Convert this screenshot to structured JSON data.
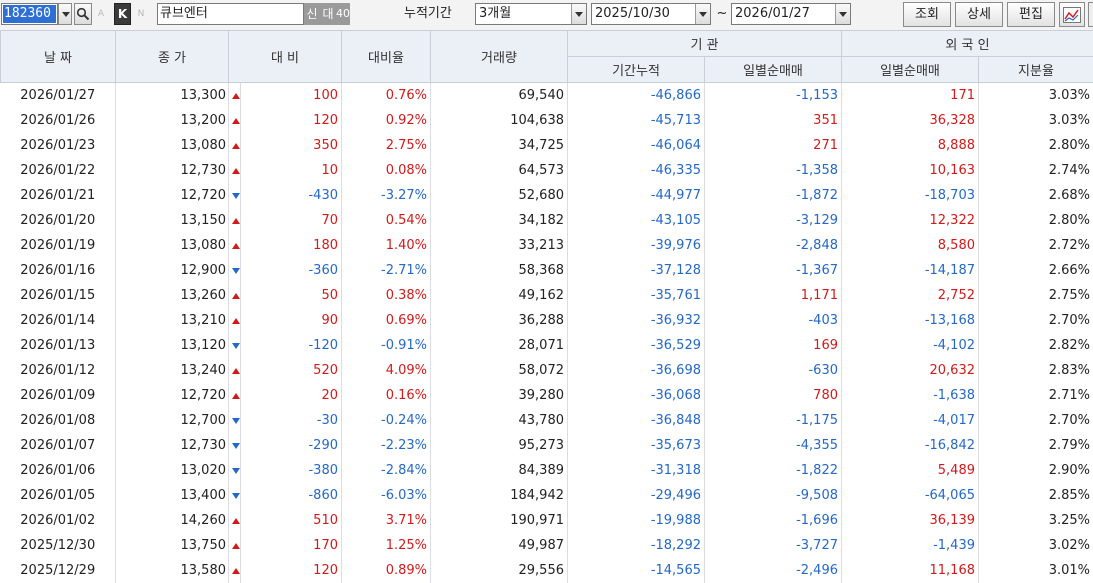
{
  "toolbar": {
    "code": "182360",
    "name": "큐브엔터",
    "k_label": "K",
    "a_label": "A",
    "n_label": "N",
    "badges": [
      "신",
      "대",
      "40"
    ],
    "period_label": "누적기간",
    "period": "3개월",
    "date_from": "2025/10/30",
    "tilde": "~",
    "date_to": "2026/01/27",
    "btn_query": "조회",
    "btn_detail": "상세",
    "btn_edit": "편집"
  },
  "headers": {
    "date": "날 짜",
    "close": "종 가",
    "change": "대 비",
    "change_rate": "대비율",
    "volume": "거래량",
    "institution": "기 관",
    "inst_cum": "기간누적",
    "inst_daily": "일별순매매",
    "foreign": "외 국 인",
    "foreign_daily": "일별순매매",
    "foreign_ratio": "지분율"
  },
  "rows": [
    {
      "date": "2026/01/27",
      "close": "13,300",
      "dir": "up",
      "change": "100",
      "rate": "0.76%",
      "volume": "69,540",
      "inst_cum": "-46,866",
      "inst_daily": "-1,153",
      "for_daily": "171",
      "ratio": "3.03%"
    },
    {
      "date": "2026/01/26",
      "close": "13,200",
      "dir": "up",
      "change": "120",
      "rate": "0.92%",
      "volume": "104,638",
      "inst_cum": "-45,713",
      "inst_daily": "351",
      "for_daily": "36,328",
      "ratio": "3.03%"
    },
    {
      "date": "2026/01/23",
      "close": "13,080",
      "dir": "up",
      "change": "350",
      "rate": "2.75%",
      "volume": "34,725",
      "inst_cum": "-46,064",
      "inst_daily": "271",
      "for_daily": "8,888",
      "ratio": "2.80%"
    },
    {
      "date": "2026/01/22",
      "close": "12,730",
      "dir": "up",
      "change": "10",
      "rate": "0.08%",
      "volume": "64,573",
      "inst_cum": "-46,335",
      "inst_daily": "-1,358",
      "for_daily": "10,163",
      "ratio": "2.74%"
    },
    {
      "date": "2026/01/21",
      "close": "12,720",
      "dir": "down",
      "change": "-430",
      "rate": "-3.27%",
      "volume": "52,680",
      "inst_cum": "-44,977",
      "inst_daily": "-1,872",
      "for_daily": "-18,703",
      "ratio": "2.68%"
    },
    {
      "date": "2026/01/20",
      "close": "13,150",
      "dir": "up",
      "change": "70",
      "rate": "0.54%",
      "volume": "34,182",
      "inst_cum": "-43,105",
      "inst_daily": "-3,129",
      "for_daily": "12,322",
      "ratio": "2.80%"
    },
    {
      "date": "2026/01/19",
      "close": "13,080",
      "dir": "up",
      "change": "180",
      "rate": "1.40%",
      "volume": "33,213",
      "inst_cum": "-39,976",
      "inst_daily": "-2,848",
      "for_daily": "8,580",
      "ratio": "2.72%"
    },
    {
      "date": "2026/01/16",
      "close": "12,900",
      "dir": "down",
      "change": "-360",
      "rate": "-2.71%",
      "volume": "58,368",
      "inst_cum": "-37,128",
      "inst_daily": "-1,367",
      "for_daily": "-14,187",
      "ratio": "2.66%"
    },
    {
      "date": "2026/01/15",
      "close": "13,260",
      "dir": "up",
      "change": "50",
      "rate": "0.38%",
      "volume": "49,162",
      "inst_cum": "-35,761",
      "inst_daily": "1,171",
      "for_daily": "2,752",
      "ratio": "2.75%"
    },
    {
      "date": "2026/01/14",
      "close": "13,210",
      "dir": "up",
      "change": "90",
      "rate": "0.69%",
      "volume": "36,288",
      "inst_cum": "-36,932",
      "inst_daily": "-403",
      "for_daily": "-13,168",
      "ratio": "2.70%"
    },
    {
      "date": "2026/01/13",
      "close": "13,120",
      "dir": "down",
      "change": "-120",
      "rate": "-0.91%",
      "volume": "28,071",
      "inst_cum": "-36,529",
      "inst_daily": "169",
      "for_daily": "-4,102",
      "ratio": "2.82%"
    },
    {
      "date": "2026/01/12",
      "close": "13,240",
      "dir": "up",
      "change": "520",
      "rate": "4.09%",
      "volume": "58,072",
      "inst_cum": "-36,698",
      "inst_daily": "-630",
      "for_daily": "20,632",
      "ratio": "2.83%"
    },
    {
      "date": "2026/01/09",
      "close": "12,720",
      "dir": "up",
      "change": "20",
      "rate": "0.16%",
      "volume": "39,280",
      "inst_cum": "-36,068",
      "inst_daily": "780",
      "for_daily": "-1,638",
      "ratio": "2.71%"
    },
    {
      "date": "2026/01/08",
      "close": "12,700",
      "dir": "down",
      "change": "-30",
      "rate": "-0.24%",
      "volume": "43,780",
      "inst_cum": "-36,848",
      "inst_daily": "-1,175",
      "for_daily": "-4,017",
      "ratio": "2.70%"
    },
    {
      "date": "2026/01/07",
      "close": "12,730",
      "dir": "down",
      "change": "-290",
      "rate": "-2.23%",
      "volume": "95,273",
      "inst_cum": "-35,673",
      "inst_daily": "-4,355",
      "for_daily": "-16,842",
      "ratio": "2.79%"
    },
    {
      "date": "2026/01/06",
      "close": "13,020",
      "dir": "down",
      "change": "-380",
      "rate": "-2.84%",
      "volume": "84,389",
      "inst_cum": "-31,318",
      "inst_daily": "-1,822",
      "for_daily": "5,489",
      "ratio": "2.90%"
    },
    {
      "date": "2026/01/05",
      "close": "13,400",
      "dir": "down",
      "change": "-860",
      "rate": "-6.03%",
      "volume": "184,942",
      "inst_cum": "-29,496",
      "inst_daily": "-9,508",
      "for_daily": "-64,065",
      "ratio": "2.85%"
    },
    {
      "date": "2026/01/02",
      "close": "14,260",
      "dir": "up",
      "change": "510",
      "rate": "3.71%",
      "volume": "190,971",
      "inst_cum": "-19,988",
      "inst_daily": "-1,696",
      "for_daily": "36,139",
      "ratio": "3.25%"
    },
    {
      "date": "2025/12/30",
      "close": "13,750",
      "dir": "up",
      "change": "170",
      "rate": "1.25%",
      "volume": "49,987",
      "inst_cum": "-18,292",
      "inst_daily": "-3,727",
      "for_daily": "-1,439",
      "ratio": "3.02%"
    },
    {
      "date": "2025/12/29",
      "close": "13,580",
      "dir": "up",
      "change": "120",
      "rate": "0.89%",
      "volume": "29,556",
      "inst_cum": "-14,565",
      "inst_daily": "-2,496",
      "for_daily": "11,168",
      "ratio": "3.01%"
    }
  ],
  "colors": {
    "up": "#d21a1a",
    "down": "#2468c8",
    "header_bg": "#ebeff6"
  }
}
